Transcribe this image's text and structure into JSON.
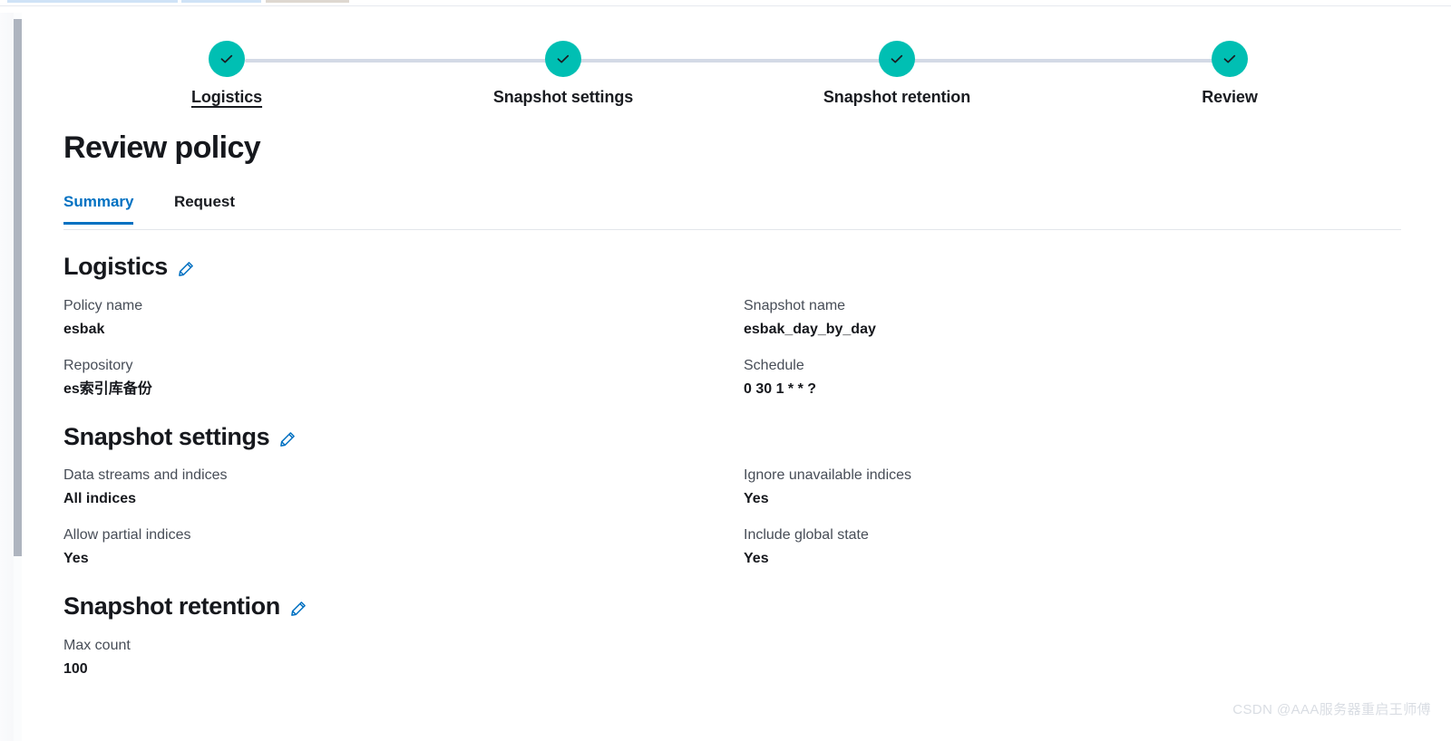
{
  "window": {
    "top_strips": [
      "tab-strip-blue-1",
      "tab-strip-blue-2",
      "tab-strip-tan-3"
    ]
  },
  "colors": {
    "step_complete": "#00BFB3",
    "step_connector": "#D3DAE6",
    "accent_blue": "#0071C2",
    "text_dark": "#16181D",
    "text_muted": "#474D57",
    "scrollbar_thumb": "#AEB4BF",
    "watermark": "#D9DDE3"
  },
  "stepper": {
    "steps": [
      {
        "label": "Logistics",
        "state": "complete",
        "current": true
      },
      {
        "label": "Snapshot settings",
        "state": "complete",
        "current": false
      },
      {
        "label": "Snapshot retention",
        "state": "complete",
        "current": false
      },
      {
        "label": "Review",
        "state": "complete",
        "current": false
      }
    ]
  },
  "page": {
    "title": "Review policy"
  },
  "tabs": [
    {
      "label": "Summary",
      "active": true
    },
    {
      "label": "Request",
      "active": false
    }
  ],
  "sections": [
    {
      "title": "Logistics",
      "edit_icon": "pencil-icon",
      "fields": [
        {
          "label": "Policy name",
          "value": "esbak"
        },
        {
          "label": "Snapshot name",
          "value": "esbak_day_by_day"
        },
        {
          "label": "Repository",
          "value": "es索引库备份"
        },
        {
          "label": "Schedule",
          "value": "0 30 1 * * ?"
        }
      ]
    },
    {
      "title": "Snapshot settings",
      "edit_icon": "pencil-icon",
      "fields": [
        {
          "label": "Data streams and indices",
          "value": "All indices"
        },
        {
          "label": "Ignore unavailable indices",
          "value": "Yes"
        },
        {
          "label": "Allow partial indices",
          "value": "Yes"
        },
        {
          "label": "Include global state",
          "value": "Yes"
        }
      ]
    },
    {
      "title": "Snapshot retention",
      "edit_icon": "pencil-icon",
      "fields": [
        {
          "label": "Max count",
          "value": "100"
        }
      ]
    }
  ],
  "watermark": "CSDN @AAA服务器重启王师傅"
}
